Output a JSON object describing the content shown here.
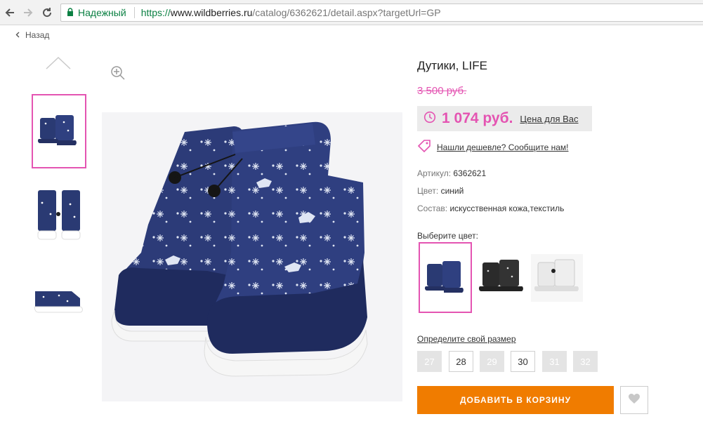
{
  "browser": {
    "secure_label": "Надежный",
    "url_proto": "https://",
    "url_host": "www.wildberries.ru",
    "url_path": "/catalog/6362621/detail.aspx?targetUrl=GP"
  },
  "page": {
    "back_label": "Назад",
    "title": "Дутики, LIFE",
    "old_price": "3 500 руб.",
    "price": "1 074 руб.",
    "price_note": "Цена для Вас",
    "cheaper_link": "Нашли дешевле? Сообщите нам!",
    "specs": [
      {
        "label": "Артикул:",
        "value": "6362621"
      },
      {
        "label": "Цвет:",
        "value": "синий"
      },
      {
        "label": "Состав:",
        "value": "искусственная кожа,текстиль"
      }
    ],
    "choose_color": "Выберите цвет:",
    "size_label": "Определите свой размер",
    "sizes": [
      {
        "label": "27",
        "available": false
      },
      {
        "label": "28",
        "available": true
      },
      {
        "label": "29",
        "available": false
      },
      {
        "label": "30",
        "available": true
      },
      {
        "label": "31",
        "available": false
      },
      {
        "label": "32",
        "available": false
      }
    ],
    "cart_button": "ДОБАВИТЬ В КОРЗИНУ"
  },
  "colors": {
    "accent": "#e454b2",
    "cart": "#f07c00",
    "boot_navy": "#2a3a73",
    "secure_green": "#0b8043"
  },
  "icons": [
    "back-arrow-icon",
    "forward-arrow-icon",
    "reload-icon",
    "lock-icon",
    "chevron-left-icon",
    "chevron-up-icon",
    "zoom-in-icon",
    "clock-icon",
    "tag-icon",
    "heart-icon"
  ]
}
